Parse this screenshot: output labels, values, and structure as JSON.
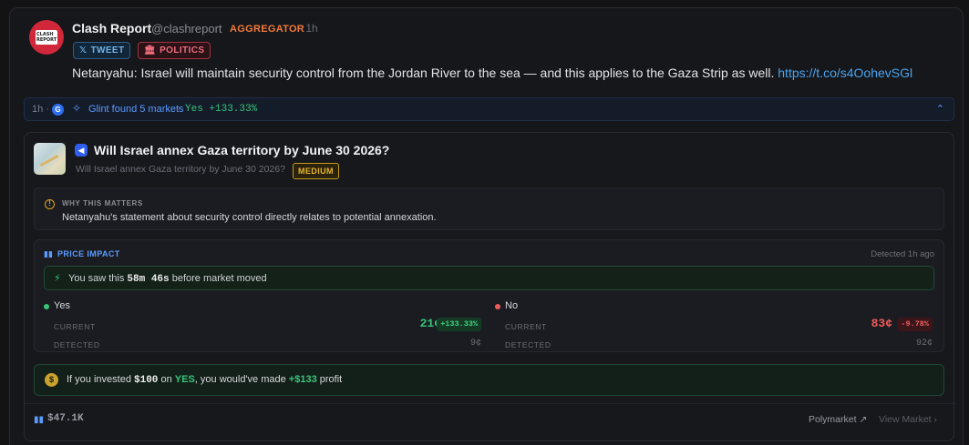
{
  "post": {
    "name": "Clash Report",
    "handle": "@clashreport",
    "role": "AGGREGATOR",
    "time": "· 1h",
    "avatar_text": "CLASH REPORT",
    "tags": [
      {
        "label": "TWEET",
        "icon": "x-logo-icon"
      },
      {
        "label": "POLITICS",
        "icon": "capitol-icon"
      }
    ],
    "text": "Netanyahu: Israel will maintain security control from the Jordan River to the sea — and this applies to the Gaza Strip as well.",
    "link": "https://t.co/s4OohevSGl"
  },
  "glint": {
    "time": "1h ·",
    "found": "Glint found 5 markets",
    "sep": "·",
    "yes_change": "Yes +133.33%"
  },
  "market": {
    "title": "Will Israel annex Gaza territory by June 30 2026?",
    "subtitle": "Will Israel annex Gaza territory by June 30 2026?",
    "badge": "MEDIUM",
    "why": {
      "heading": "WHY THIS MATTERS",
      "body": "Netanyahu's statement about security control directly relates to potential annexation."
    },
    "impact": {
      "heading": "PRICE IMPACT",
      "detected": "Detected 1h ago",
      "saw_prefix": "You saw this",
      "saw_time": "58m 46s",
      "saw_suffix": "before market moved",
      "yes": {
        "label": "Yes",
        "current_label": "CURRENT",
        "current": "21¢",
        "change": "+133.33%",
        "detected_label": "DETECTED",
        "detected": "9¢",
        "color": "#36c57a"
      },
      "no": {
        "label": "No",
        "current_label": "CURRENT",
        "current": "83¢",
        "change": "-9.78%",
        "detected_label": "DETECTED",
        "detected": "92¢",
        "color": "#ef5a5a"
      }
    },
    "invest": {
      "p1": "If you invested",
      "amount": "$100",
      "p2": "on",
      "side": "YES",
      "p3": ", you would've made",
      "profit": "+$133",
      "p4": "profit"
    },
    "volume": "$47.1K",
    "source": "Polymarket",
    "view": "View Market"
  }
}
